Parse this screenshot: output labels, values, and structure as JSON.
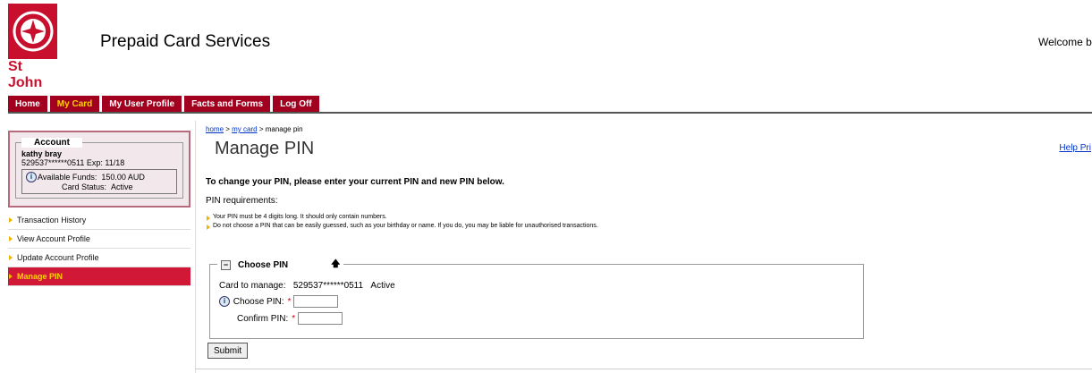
{
  "header": {
    "logo_text": "St John",
    "app_title": "Prepaid Card Services",
    "welcome": "Welcome bra"
  },
  "nav": {
    "items": [
      "Home",
      "My Card",
      "My User Profile",
      "Facts and Forms",
      "Log Off"
    ],
    "active": "My Card"
  },
  "account": {
    "legend": "Account",
    "name": "kathy bray",
    "card_line": "529537******0511 Exp: 11/18",
    "funds_label": "Available Funds:",
    "funds_value": "150.00 AUD",
    "status_label": "Card Status:",
    "status_value": "Active"
  },
  "sidebar": {
    "links": [
      "Transaction History",
      "View Account Profile",
      "Update Account Profile",
      "Manage PIN"
    ],
    "active": "Manage PIN"
  },
  "breadcrumb": {
    "home": "home",
    "sep1": " > ",
    "mycard": "my card",
    "sep2": " > ",
    "current": "manage pin"
  },
  "main": {
    "title": "Manage PIN",
    "help_links": "Help Pri",
    "instructions": "To change your PIN, please enter your current PIN and new PIN below.",
    "req_title": "PIN requirements:",
    "requirements": [
      "Your PIN must be 4 digits long. It should only contain numbers.",
      "Do not choose a PIN that can be easily guessed, such as your birthday or name. If you do, you may be liable for unauthorised transactions."
    ]
  },
  "pin_form": {
    "legend": "Choose PIN",
    "toggle_symbol": "−",
    "up_symbol": "🡅",
    "card_label": "Card to manage:",
    "card_value": "529537******0511",
    "card_status": "Active",
    "choose_label": "Choose PIN:",
    "confirm_label": "Confirm PIN:",
    "required_mark": "*",
    "submit_label": "Submit"
  },
  "colors": {
    "brand_red": "#a1001e",
    "active_nav_text": "#ffd200",
    "sidebar_active": "#d11937",
    "link_blue": "#0033cc"
  }
}
